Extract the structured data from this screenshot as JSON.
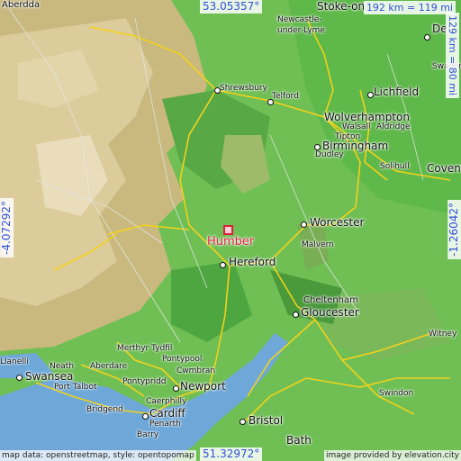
{
  "coords": {
    "top": "53.05357°",
    "bottom": "51.32972°",
    "left": "-4.07292°",
    "right": "-1.26042°"
  },
  "scale": {
    "horizontal": "192 km = 119 mi",
    "vertical": "129 km = 80 mi"
  },
  "credits": {
    "left": "map data: openstreetmap, style: opentopomap",
    "right": "image provided by elevation.city"
  },
  "place": {
    "name": "Humber"
  },
  "colors": {
    "lowland": "#5cb848",
    "upland": "#d8c890",
    "sea": "#6ea8d8",
    "roads": "#f2d21a",
    "accent": "#e0203a"
  },
  "towns": [
    "Stoke-on-",
    "Newcastle-\nunder-Lyme",
    "Der",
    "Swadlin",
    "Lichfield",
    "Shrewsbury",
    "Telford",
    "Wolverhampton",
    "Walsall",
    "Aldridge",
    "Tipton",
    "Birmingham",
    "Dudley",
    "Solihull",
    "Coventr",
    "Worcester",
    "Malvern",
    "Hereford",
    "Cheltenham",
    "Gloucester",
    "Witney",
    "Merthyr Tydfil",
    "Pontypool",
    "Cwmbran",
    "Aberdare",
    "Neath",
    "Swansea",
    "Port Talbot",
    "Pontypridd",
    "Caerphilly",
    "Newport",
    "Cardiff",
    "Bridgend",
    "Penarth",
    "Barry",
    "Bristol",
    "Bath",
    "Swindon",
    "Llanelli",
    "Aberdda"
  ]
}
